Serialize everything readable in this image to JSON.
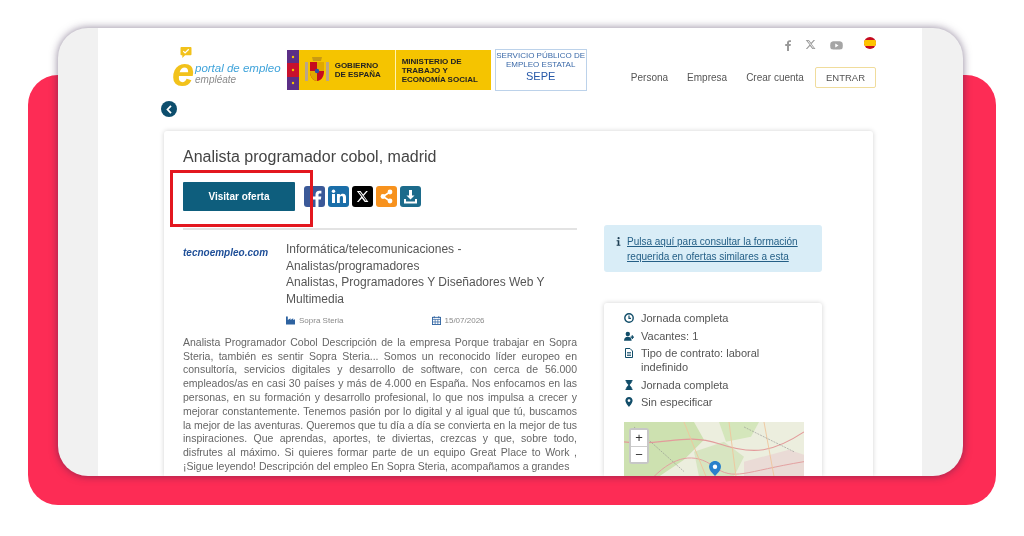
{
  "header": {
    "logo": {
      "mark": "e",
      "name": "portal de empleo",
      "tagline": "empléate"
    },
    "ministry_logo": {
      "government": "GOBIERNO DE ESPAÑA",
      "ministry": "MINISTERIO DE TRABAJO Y ECONOMÍA SOCIAL"
    },
    "sepe_logo": {
      "caption": "SERVICIO PÚBLICO DE EMPLEO ESTATAL",
      "acronym": "SEPE"
    },
    "nav": [
      {
        "label": "Persona",
        "kind": "link"
      },
      {
        "label": "Empresa",
        "kind": "link"
      },
      {
        "label": "Crear cuenta",
        "kind": "link"
      },
      {
        "label": "ENTRAR",
        "kind": "button"
      }
    ]
  },
  "job": {
    "title": "Analista programador cobol, madrid",
    "apply_button": {
      "label": "Visitar oferta",
      "highlighted": true
    },
    "company_logo": "tecnoempleo.com",
    "categories": [
      "Informática/telecomunicaciones - Analistas/programadores",
      "Analistas, Programadores Y Diseñadores Web Y Multimedia"
    ],
    "company": "Sopra Steria",
    "date": "15/07/2026",
    "description": "Analista Programador Cobol Descripción de la empresa Porque trabajar en Sopra Steria, también es sentir Sopra Steria... Somos un reconocido líder europeo en consultoría, servicios digitales y desarrollo de software, con cerca de 56.000 empleados/as en casi 30 países y más de 4.000 en España. Nos enfocamos en las personas, en su formación y desarrollo profesional, lo que nos impulsa a crecer y mejorar constantemente. Tenemos pasión por lo digital y al igual que tú, buscamos la mejor de las aventuras. Queremos que tu día a día se convierta en la mejor de tus inspiraciones. Que aprendas, aportes, te diviertas, crezcas y que, sobre todo, disfrutes al máximo. Si quieres formar parte de un equipo Great Place to Work , ¡Sigue leyendo! Descripción del empleo En Sopra Steria, acompañamos a grandes"
  },
  "sidebar": {
    "info_link": "Pulsa aquí para consultar la formación requerida en ofertas similares a esta",
    "details": [
      {
        "kind": "schedule",
        "text": "Jornada completa"
      },
      {
        "kind": "vacancies",
        "text": "Vacantes: 1"
      },
      {
        "kind": "contract",
        "text": "Tipo de contrato: laboral indefinido"
      },
      {
        "kind": "hours",
        "text": "Jornada completa"
      },
      {
        "kind": "location",
        "text": "Sin especificar"
      }
    ],
    "map": {
      "zoom_in": "+",
      "zoom_out": "−"
    }
  }
}
